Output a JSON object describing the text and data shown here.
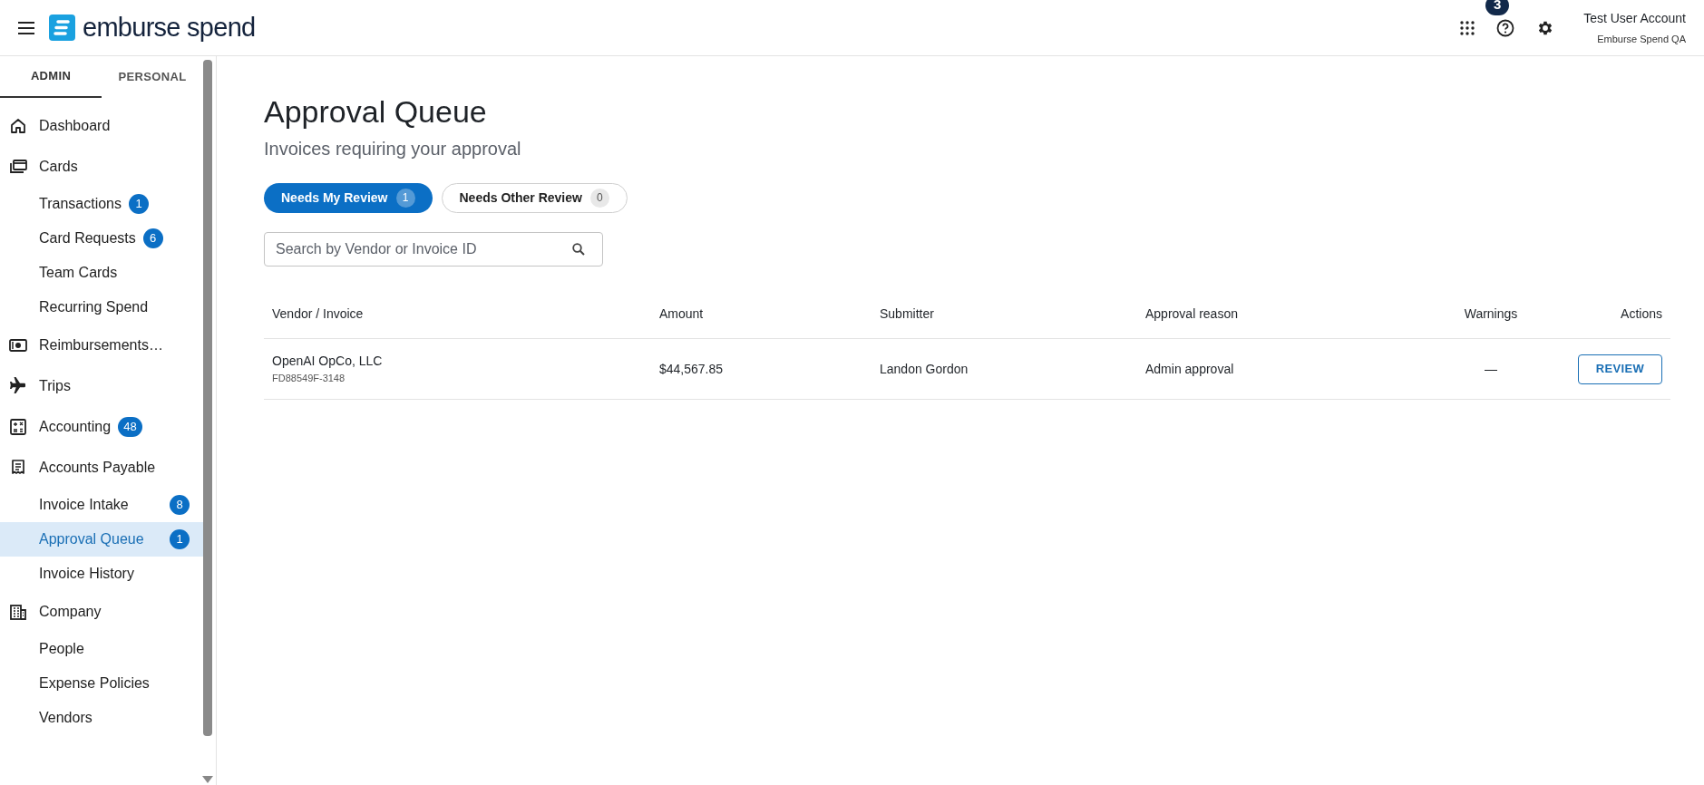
{
  "header": {
    "logo_text": "emburse spend",
    "notification_count": "3",
    "user_name": "Test User Account",
    "company": "Emburse Spend QA"
  },
  "sidebar": {
    "tabs": [
      {
        "label": "ADMIN",
        "selected": true
      },
      {
        "label": "PERSONAL",
        "selected": false
      }
    ],
    "sections": [
      {
        "label": "Dashboard",
        "selected": false
      },
      {
        "label": "Cards",
        "selected": false,
        "children": [
          {
            "label": "Transactions",
            "badge": "1",
            "selected": false
          },
          {
            "label": "Card Requests",
            "badge": "6",
            "selected": false
          },
          {
            "label": "Team Cards",
            "selected": false
          },
          {
            "label": "Recurring Spend",
            "selected": false
          }
        ]
      },
      {
        "label": "Reimbursements…",
        "selected": false
      },
      {
        "label": "Trips",
        "selected": false
      },
      {
        "label": "Accounting",
        "badge": "48",
        "selected": false
      },
      {
        "label": "Accounts Payable",
        "selected": false,
        "children": [
          {
            "label": "Invoice Intake",
            "badge": "8",
            "selected": false
          },
          {
            "label": "Approval Queue",
            "badge": "1",
            "selected": true
          },
          {
            "label": "Invoice History",
            "selected": false
          }
        ]
      },
      {
        "label": "Company",
        "selected": false,
        "children": [
          {
            "label": "People",
            "selected": false
          },
          {
            "label": "Expense Policies",
            "selected": false
          },
          {
            "label": "Vendors",
            "selected": false
          }
        ]
      }
    ]
  },
  "page": {
    "title": "Approval Queue",
    "subtitle": "Invoices requiring your approval",
    "filters": [
      {
        "label": "Needs My Review",
        "count": "1",
        "selected": true
      },
      {
        "label": "Needs Other Review",
        "count": "0",
        "selected": false
      }
    ],
    "search": {
      "placeholder": "Search by Vendor or Invoice ID"
    },
    "table": {
      "columns": [
        "Vendor / Invoice",
        "Amount",
        "Submitter",
        "Approval reason",
        "Warnings",
        "Actions"
      ],
      "rows": [
        {
          "vendor": "OpenAI OpCo, LLC",
          "invoice_id": "FD88549F-3148",
          "amount": "$44,567.85",
          "submitter": "Landon Gordon",
          "approval_reason": "Admin approval",
          "warnings": "—",
          "action": "REVIEW"
        }
      ]
    }
  }
}
